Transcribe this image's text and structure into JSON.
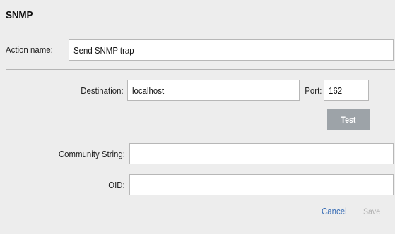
{
  "dialog": {
    "title": "SNMP"
  },
  "action": {
    "label": "Action name:",
    "value": "Send SNMP trap"
  },
  "destination": {
    "label": "Destination:",
    "value": "localhost"
  },
  "port": {
    "label": "Port:",
    "value": "162"
  },
  "test_button": {
    "label": "Test"
  },
  "community": {
    "label": "Community String:",
    "value": ""
  },
  "oid": {
    "label": "OID:",
    "value": ""
  },
  "footer": {
    "cancel_label": "Cancel",
    "save_label": "Save"
  },
  "colors": {
    "panel_background": "#ededed",
    "link": "#3b6fb6",
    "test_button_background": "#9da3a8",
    "disabled_text": "#b3b3b3"
  }
}
